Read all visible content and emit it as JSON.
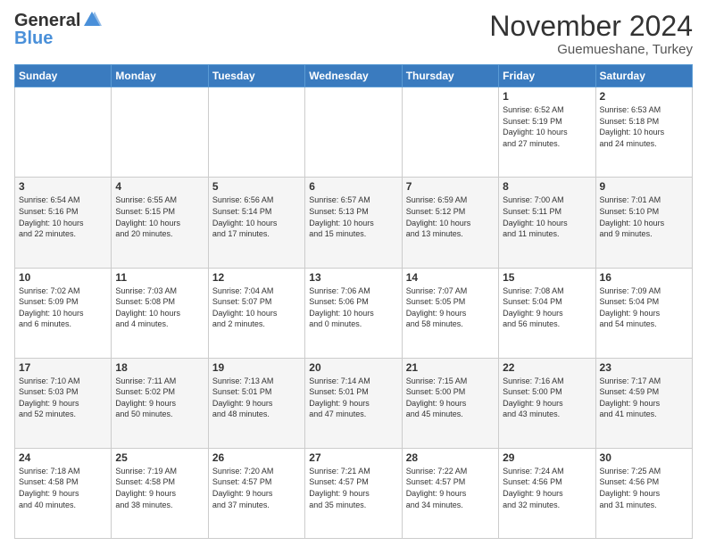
{
  "logo": {
    "text_general": "General",
    "text_blue": "Blue"
  },
  "header": {
    "month_year": "November 2024",
    "location": "Guemueshane, Turkey"
  },
  "weekdays": [
    "Sunday",
    "Monday",
    "Tuesday",
    "Wednesday",
    "Thursday",
    "Friday",
    "Saturday"
  ],
  "weeks": [
    [
      {
        "day": "",
        "info": ""
      },
      {
        "day": "",
        "info": ""
      },
      {
        "day": "",
        "info": ""
      },
      {
        "day": "",
        "info": ""
      },
      {
        "day": "",
        "info": ""
      },
      {
        "day": "1",
        "info": "Sunrise: 6:52 AM\nSunset: 5:19 PM\nDaylight: 10 hours\nand 27 minutes."
      },
      {
        "day": "2",
        "info": "Sunrise: 6:53 AM\nSunset: 5:18 PM\nDaylight: 10 hours\nand 24 minutes."
      }
    ],
    [
      {
        "day": "3",
        "info": "Sunrise: 6:54 AM\nSunset: 5:16 PM\nDaylight: 10 hours\nand 22 minutes."
      },
      {
        "day": "4",
        "info": "Sunrise: 6:55 AM\nSunset: 5:15 PM\nDaylight: 10 hours\nand 20 minutes."
      },
      {
        "day": "5",
        "info": "Sunrise: 6:56 AM\nSunset: 5:14 PM\nDaylight: 10 hours\nand 17 minutes."
      },
      {
        "day": "6",
        "info": "Sunrise: 6:57 AM\nSunset: 5:13 PM\nDaylight: 10 hours\nand 15 minutes."
      },
      {
        "day": "7",
        "info": "Sunrise: 6:59 AM\nSunset: 5:12 PM\nDaylight: 10 hours\nand 13 minutes."
      },
      {
        "day": "8",
        "info": "Sunrise: 7:00 AM\nSunset: 5:11 PM\nDaylight: 10 hours\nand 11 minutes."
      },
      {
        "day": "9",
        "info": "Sunrise: 7:01 AM\nSunset: 5:10 PM\nDaylight: 10 hours\nand 9 minutes."
      }
    ],
    [
      {
        "day": "10",
        "info": "Sunrise: 7:02 AM\nSunset: 5:09 PM\nDaylight: 10 hours\nand 6 minutes."
      },
      {
        "day": "11",
        "info": "Sunrise: 7:03 AM\nSunset: 5:08 PM\nDaylight: 10 hours\nand 4 minutes."
      },
      {
        "day": "12",
        "info": "Sunrise: 7:04 AM\nSunset: 5:07 PM\nDaylight: 10 hours\nand 2 minutes."
      },
      {
        "day": "13",
        "info": "Sunrise: 7:06 AM\nSunset: 5:06 PM\nDaylight: 10 hours\nand 0 minutes."
      },
      {
        "day": "14",
        "info": "Sunrise: 7:07 AM\nSunset: 5:05 PM\nDaylight: 9 hours\nand 58 minutes."
      },
      {
        "day": "15",
        "info": "Sunrise: 7:08 AM\nSunset: 5:04 PM\nDaylight: 9 hours\nand 56 minutes."
      },
      {
        "day": "16",
        "info": "Sunrise: 7:09 AM\nSunset: 5:04 PM\nDaylight: 9 hours\nand 54 minutes."
      }
    ],
    [
      {
        "day": "17",
        "info": "Sunrise: 7:10 AM\nSunset: 5:03 PM\nDaylight: 9 hours\nand 52 minutes."
      },
      {
        "day": "18",
        "info": "Sunrise: 7:11 AM\nSunset: 5:02 PM\nDaylight: 9 hours\nand 50 minutes."
      },
      {
        "day": "19",
        "info": "Sunrise: 7:13 AM\nSunset: 5:01 PM\nDaylight: 9 hours\nand 48 minutes."
      },
      {
        "day": "20",
        "info": "Sunrise: 7:14 AM\nSunset: 5:01 PM\nDaylight: 9 hours\nand 47 minutes."
      },
      {
        "day": "21",
        "info": "Sunrise: 7:15 AM\nSunset: 5:00 PM\nDaylight: 9 hours\nand 45 minutes."
      },
      {
        "day": "22",
        "info": "Sunrise: 7:16 AM\nSunset: 5:00 PM\nDaylight: 9 hours\nand 43 minutes."
      },
      {
        "day": "23",
        "info": "Sunrise: 7:17 AM\nSunset: 4:59 PM\nDaylight: 9 hours\nand 41 minutes."
      }
    ],
    [
      {
        "day": "24",
        "info": "Sunrise: 7:18 AM\nSunset: 4:58 PM\nDaylight: 9 hours\nand 40 minutes."
      },
      {
        "day": "25",
        "info": "Sunrise: 7:19 AM\nSunset: 4:58 PM\nDaylight: 9 hours\nand 38 minutes."
      },
      {
        "day": "26",
        "info": "Sunrise: 7:20 AM\nSunset: 4:57 PM\nDaylight: 9 hours\nand 37 minutes."
      },
      {
        "day": "27",
        "info": "Sunrise: 7:21 AM\nSunset: 4:57 PM\nDaylight: 9 hours\nand 35 minutes."
      },
      {
        "day": "28",
        "info": "Sunrise: 7:22 AM\nSunset: 4:57 PM\nDaylight: 9 hours\nand 34 minutes."
      },
      {
        "day": "29",
        "info": "Sunrise: 7:24 AM\nSunset: 4:56 PM\nDaylight: 9 hours\nand 32 minutes."
      },
      {
        "day": "30",
        "info": "Sunrise: 7:25 AM\nSunset: 4:56 PM\nDaylight: 9 hours\nand 31 minutes."
      }
    ]
  ]
}
